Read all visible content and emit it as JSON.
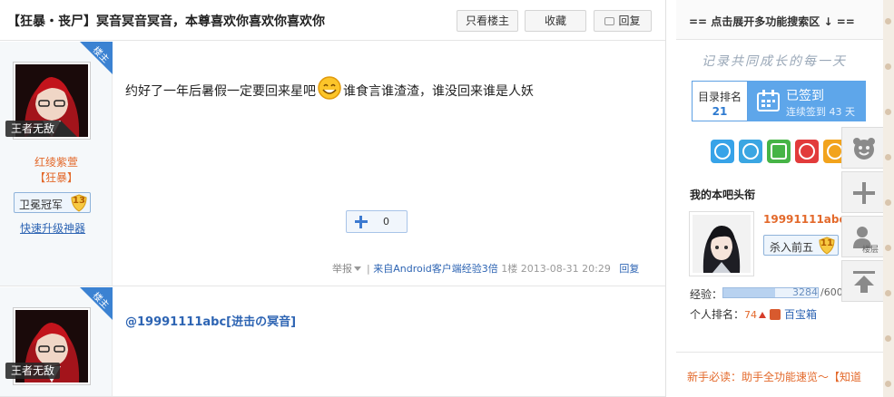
{
  "thread": {
    "title": "【狂暴・丧尸】冥音冥音冥音，本尊喜欢你喜欢你喜欢你",
    "btn_louzhu": "只看楼主",
    "btn_fav": "收藏",
    "btn_reply": "回复"
  },
  "posts": [
    {
      "badge": "楼主",
      "username": "王者无敌",
      "title1": "红绫紫萱",
      "title2": "【狂暴】",
      "level_name": "卫冕冠军",
      "level": "13",
      "upgrade": "快速升级神器",
      "content_before": "约好了一年后暑假一定要回来星吧",
      "content_after": "谁食言谁渣渣，谁没回来谁是人妖",
      "like_count": "0",
      "report": "举报",
      "source": "来自Android客户端经验3倍",
      "floor": "1楼",
      "time": "2013-08-31 20:29",
      "reply": "回复"
    },
    {
      "badge": "楼主",
      "username": "王者无敌",
      "content": "@19991111abc[进击の冥音]"
    }
  ],
  "sidebar": {
    "header": "== 点击展开多功能搜索区 ↓ ==",
    "slogan": "记录共同成长的每一天",
    "rank_label": "目录排名",
    "rank_value": "21",
    "signed_label": "已签到",
    "signed_days": "连续签到 43 天",
    "head_title": "我的本吧头衔",
    "head_name": "19991111abc",
    "head_level_name": "杀入前五",
    "head_level": "11",
    "exp_label": "经验：",
    "exp_value": "3284",
    "exp_max": "/6000",
    "exp_fraction": 0.547,
    "rank_text": "个人排名：",
    "rank_num": "74",
    "treasure": "百宝箱",
    "news": "新手必读：助手全功能速览～【知道"
  },
  "float_toolbar": {
    "tag_label": "楼层"
  },
  "colors": {
    "accent": "#2d64b3",
    "orange": "#e3692b",
    "signed": "#5ea6ea"
  }
}
